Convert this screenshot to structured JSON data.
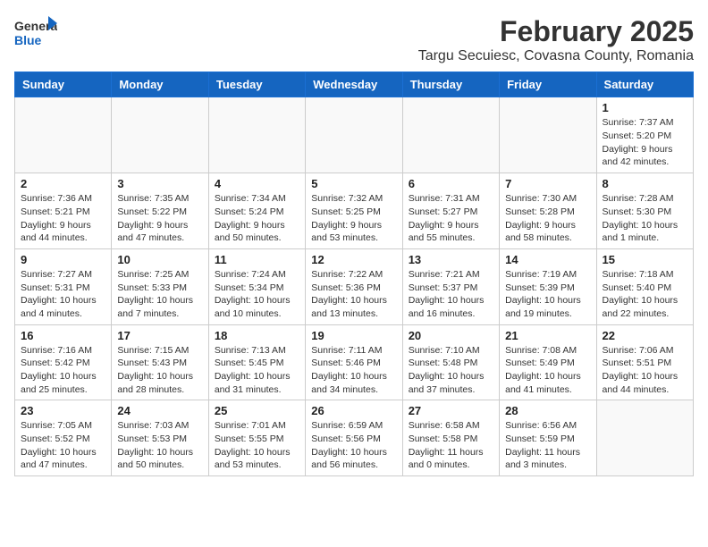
{
  "header": {
    "logo": {
      "general": "General",
      "blue": "Blue"
    },
    "title": "February 2025",
    "subtitle": "Targu Secuiesc, Covasna County, Romania"
  },
  "weekdays": [
    "Sunday",
    "Monday",
    "Tuesday",
    "Wednesday",
    "Thursday",
    "Friday",
    "Saturday"
  ],
  "weeks": [
    [
      {
        "day": "",
        "info": ""
      },
      {
        "day": "",
        "info": ""
      },
      {
        "day": "",
        "info": ""
      },
      {
        "day": "",
        "info": ""
      },
      {
        "day": "",
        "info": ""
      },
      {
        "day": "",
        "info": ""
      },
      {
        "day": "1",
        "info": "Sunrise: 7:37 AM\nSunset: 5:20 PM\nDaylight: 9 hours and 42 minutes."
      }
    ],
    [
      {
        "day": "2",
        "info": "Sunrise: 7:36 AM\nSunset: 5:21 PM\nDaylight: 9 hours and 44 minutes."
      },
      {
        "day": "3",
        "info": "Sunrise: 7:35 AM\nSunset: 5:22 PM\nDaylight: 9 hours and 47 minutes."
      },
      {
        "day": "4",
        "info": "Sunrise: 7:34 AM\nSunset: 5:24 PM\nDaylight: 9 hours and 50 minutes."
      },
      {
        "day": "5",
        "info": "Sunrise: 7:32 AM\nSunset: 5:25 PM\nDaylight: 9 hours and 53 minutes."
      },
      {
        "day": "6",
        "info": "Sunrise: 7:31 AM\nSunset: 5:27 PM\nDaylight: 9 hours and 55 minutes."
      },
      {
        "day": "7",
        "info": "Sunrise: 7:30 AM\nSunset: 5:28 PM\nDaylight: 9 hours and 58 minutes."
      },
      {
        "day": "8",
        "info": "Sunrise: 7:28 AM\nSunset: 5:30 PM\nDaylight: 10 hours and 1 minute."
      }
    ],
    [
      {
        "day": "9",
        "info": "Sunrise: 7:27 AM\nSunset: 5:31 PM\nDaylight: 10 hours and 4 minutes."
      },
      {
        "day": "10",
        "info": "Sunrise: 7:25 AM\nSunset: 5:33 PM\nDaylight: 10 hours and 7 minutes."
      },
      {
        "day": "11",
        "info": "Sunrise: 7:24 AM\nSunset: 5:34 PM\nDaylight: 10 hours and 10 minutes."
      },
      {
        "day": "12",
        "info": "Sunrise: 7:22 AM\nSunset: 5:36 PM\nDaylight: 10 hours and 13 minutes."
      },
      {
        "day": "13",
        "info": "Sunrise: 7:21 AM\nSunset: 5:37 PM\nDaylight: 10 hours and 16 minutes."
      },
      {
        "day": "14",
        "info": "Sunrise: 7:19 AM\nSunset: 5:39 PM\nDaylight: 10 hours and 19 minutes."
      },
      {
        "day": "15",
        "info": "Sunrise: 7:18 AM\nSunset: 5:40 PM\nDaylight: 10 hours and 22 minutes."
      }
    ],
    [
      {
        "day": "16",
        "info": "Sunrise: 7:16 AM\nSunset: 5:42 PM\nDaylight: 10 hours and 25 minutes."
      },
      {
        "day": "17",
        "info": "Sunrise: 7:15 AM\nSunset: 5:43 PM\nDaylight: 10 hours and 28 minutes."
      },
      {
        "day": "18",
        "info": "Sunrise: 7:13 AM\nSunset: 5:45 PM\nDaylight: 10 hours and 31 minutes."
      },
      {
        "day": "19",
        "info": "Sunrise: 7:11 AM\nSunset: 5:46 PM\nDaylight: 10 hours and 34 minutes."
      },
      {
        "day": "20",
        "info": "Sunrise: 7:10 AM\nSunset: 5:48 PM\nDaylight: 10 hours and 37 minutes."
      },
      {
        "day": "21",
        "info": "Sunrise: 7:08 AM\nSunset: 5:49 PM\nDaylight: 10 hours and 41 minutes."
      },
      {
        "day": "22",
        "info": "Sunrise: 7:06 AM\nSunset: 5:51 PM\nDaylight: 10 hours and 44 minutes."
      }
    ],
    [
      {
        "day": "23",
        "info": "Sunrise: 7:05 AM\nSunset: 5:52 PM\nDaylight: 10 hours and 47 minutes."
      },
      {
        "day": "24",
        "info": "Sunrise: 7:03 AM\nSunset: 5:53 PM\nDaylight: 10 hours and 50 minutes."
      },
      {
        "day": "25",
        "info": "Sunrise: 7:01 AM\nSunset: 5:55 PM\nDaylight: 10 hours and 53 minutes."
      },
      {
        "day": "26",
        "info": "Sunrise: 6:59 AM\nSunset: 5:56 PM\nDaylight: 10 hours and 56 minutes."
      },
      {
        "day": "27",
        "info": "Sunrise: 6:58 AM\nSunset: 5:58 PM\nDaylight: 11 hours and 0 minutes."
      },
      {
        "day": "28",
        "info": "Sunrise: 6:56 AM\nSunset: 5:59 PM\nDaylight: 11 hours and 3 minutes."
      },
      {
        "day": "",
        "info": ""
      }
    ]
  ]
}
